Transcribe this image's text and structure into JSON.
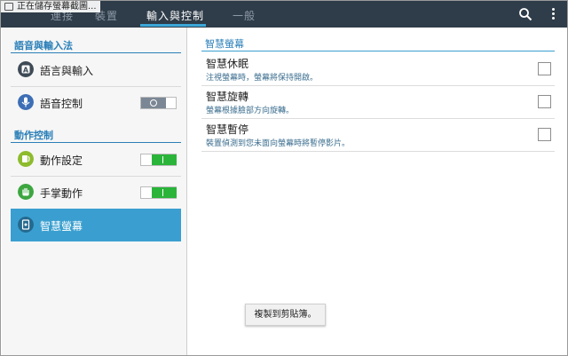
{
  "notification": {
    "text": "正在儲存螢幕截圖..."
  },
  "tabs": [
    {
      "label": "連接"
    },
    {
      "label": "裝置"
    },
    {
      "label": "輸入與控制"
    },
    {
      "label": "一般"
    }
  ],
  "icons": {
    "search": "search-icon",
    "more": "more-vert-icon"
  },
  "sidebar": {
    "section1_title": "語音與輸入法",
    "section2_title": "動作控制",
    "items": [
      {
        "label": "語言與輸入",
        "icon": "keyboard-a-icon"
      },
      {
        "label": "語音控制",
        "icon": "microphone-icon",
        "toggle": "off"
      },
      {
        "label": "動作設定",
        "icon": "motion-icon",
        "toggle": "on"
      },
      {
        "label": "手掌動作",
        "icon": "palm-icon",
        "toggle": "on"
      },
      {
        "label": "智慧螢幕",
        "icon": "smart-screen-icon",
        "selected": true
      }
    ]
  },
  "main": {
    "title": "智慧螢幕",
    "options": [
      {
        "title": "智慧休眠",
        "desc": "注視螢幕時，螢幕將保持開啟。",
        "checked": false
      },
      {
        "title": "智慧旋轉",
        "desc": "螢幕根據臉部方向旋轉。",
        "checked": false
      },
      {
        "title": "智慧暫停",
        "desc": "裝置偵測到您未面向螢幕時將暫停影片。",
        "checked": false
      }
    ]
  },
  "popup": {
    "copy_label": "複製到剪貼簿。"
  },
  "colors": {
    "accent": "#3a9fd0",
    "topbar": "#2f3c49",
    "toggle_on": "#2ab43a",
    "section_title": "#2a7fb8"
  }
}
